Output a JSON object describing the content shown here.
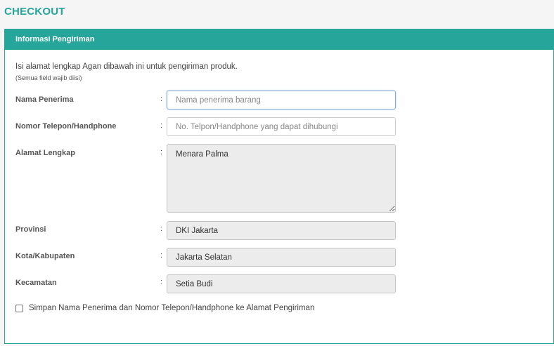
{
  "page": {
    "title": "CHECKOUT"
  },
  "panel": {
    "header": "Informasi Pengiriman",
    "intro": "Isi alamat lengkap Agan dibawah ini untuk pengiriman produk.",
    "note": "(Semua field wajib diisi)"
  },
  "form": {
    "separator": ":",
    "recipient": {
      "label": "Nama Penerima",
      "placeholder": "Nama penerima barang",
      "value": ""
    },
    "phone": {
      "label": "Nomor Telepon/Handphone",
      "placeholder": "No. Telpon/Handphone yang dapat dihubungi",
      "value": ""
    },
    "address": {
      "label": "Alamat Lengkap",
      "value": "Menara Palma"
    },
    "province": {
      "label": "Provinsi",
      "value": "DKI Jakarta"
    },
    "city": {
      "label": "Kota/Kabupaten",
      "value": "Jakarta Selatan"
    },
    "district": {
      "label": "Kecamatan",
      "value": "Setia Budi"
    },
    "save_checkbox": {
      "label": "Simpan Nama Penerima dan Nomor Telepon/Handphone ke Alamat Pengiriman",
      "checked": false
    }
  }
}
